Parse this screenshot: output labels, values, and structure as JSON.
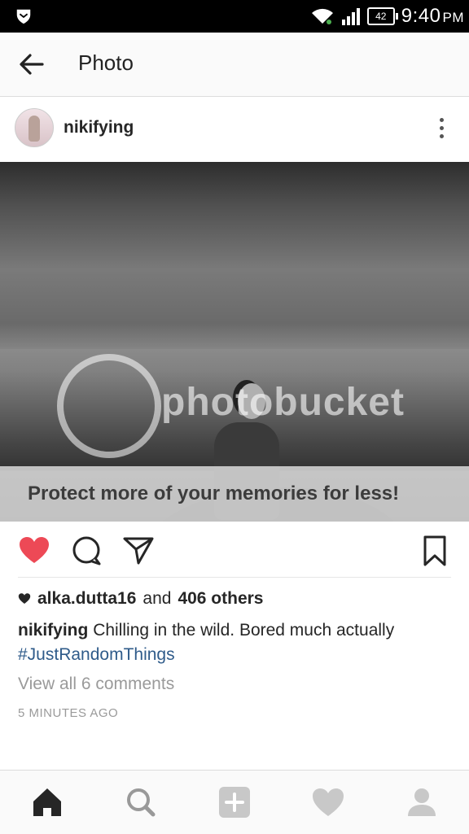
{
  "status_bar": {
    "time": "9:40",
    "ampm": "PM",
    "battery": "42",
    "icons": [
      "shield-icon",
      "wifi-icon",
      "signal-icon",
      "battery-icon"
    ]
  },
  "app_bar": {
    "title": "Photo",
    "back_icon": "arrow-back-icon"
  },
  "post": {
    "username": "nikifying",
    "photo_watermark": "photobucket",
    "photo_banner": "Protect more of your memories for less!",
    "likes": {
      "first_user": "alka.dutta16",
      "and": "and",
      "others": "406 others"
    },
    "caption": {
      "user": "nikifying",
      "text": "Chilling in the wild. Bored much actually",
      "hashtag": "#JustRandomThings"
    },
    "view_comments": "View all 6 comments",
    "timestamp": "5 MINUTES AGO",
    "liked": true,
    "like_color": "#ed4956"
  },
  "tab_bar": {
    "items": [
      "home-icon",
      "search-icon",
      "add-icon",
      "heart-icon",
      "profile-icon"
    ]
  }
}
